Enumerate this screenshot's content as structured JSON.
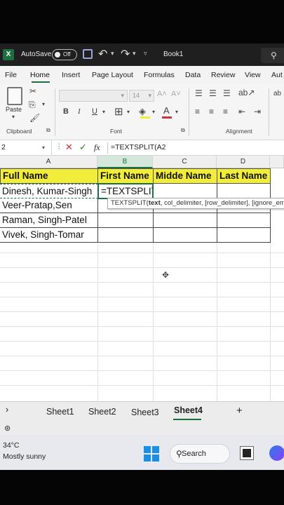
{
  "title_bar": {
    "app_icon": "X",
    "autosave_label": "AutoSave",
    "toggle_state": "Off",
    "document_title": "Book1",
    "search_icon": "⚲"
  },
  "ribbon_tabs": [
    "File",
    "Home",
    "Insert",
    "Page Layout",
    "Formulas",
    "Data",
    "Review",
    "View",
    "Aut"
  ],
  "ribbon": {
    "paste_label": "Paste",
    "clipboard_label": "Clipboard",
    "font_label": "Font",
    "alignment_label": "Alignment",
    "font_size": "14",
    "bold": "B",
    "italic": "I",
    "underline": "U"
  },
  "formula_bar": {
    "name_box": "2",
    "fx": "fx",
    "formula": "=TEXTSPLIT(A2"
  },
  "columns": [
    "A",
    "B",
    "C",
    "D"
  ],
  "headers": {
    "a": "Full Name",
    "b": "First Name",
    "c": "Midde Name",
    "d": "Last Name"
  },
  "rows": [
    {
      "a": "Dinesh, Kumar-Singh",
      "b_prefix": "=TEXTSPLIT(",
      "b_ref": "A2"
    },
    {
      "a": "Veer-Pratap,Sen"
    },
    {
      "a": "Raman, Singh-Patel"
    },
    {
      "a": "Vivek, Singh-Tomar"
    }
  ],
  "tooltip": {
    "fn": "TEXTSPLIT(",
    "arg_bold": "text",
    "rest": ", col_delimiter, [row_delimiter], [ignore_em"
  },
  "sheets": [
    "Sheet1",
    "Sheet2",
    "Sheet3",
    "Sheet4"
  ],
  "add_sheet": "+",
  "nav_arrow": "›",
  "weather": {
    "temp": "34°C",
    "desc": "Mostly sunny"
  },
  "taskbar": {
    "search_label": "Search"
  },
  "colors": {
    "excel_green": "#1d6f42",
    "header_fill": "#f2ec3a",
    "ref_blue": "#1f5fbf"
  }
}
